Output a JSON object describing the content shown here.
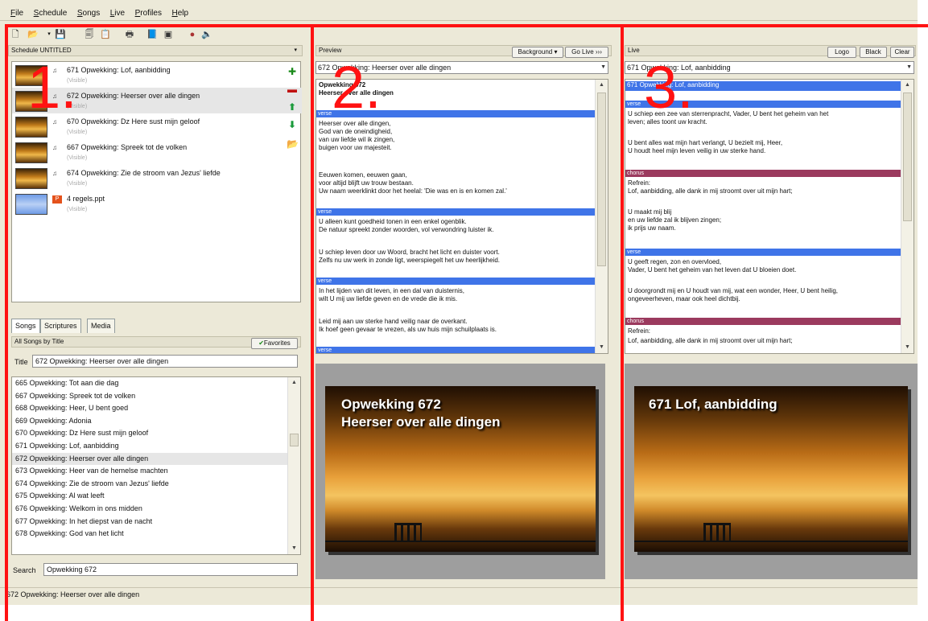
{
  "menu": [
    "File",
    "Schedule",
    "Songs",
    "Live",
    "Profiles",
    "Help"
  ],
  "toolbar_icons": [
    "new-icon",
    "open-icon",
    "save-icon",
    "copy-icon",
    "paste-icon",
    "print-icon",
    "book-icon",
    "window-icon",
    "record-icon",
    "speaker-icon"
  ],
  "schedule": {
    "header": "Schedule UNTITLED",
    "items": [
      {
        "title": "671 Opwekking: Lof, aanbidding",
        "sub": "(Visible)"
      },
      {
        "title": "672 Opwekking: Heerser over alle dingen",
        "sub": "(Visible)"
      },
      {
        "title": "670 Opwekking: Dz Here sust mijn geloof",
        "sub": "(Visible)"
      },
      {
        "title": "667 Opwekking: Spreek tot de volken",
        "sub": "(Visible)"
      },
      {
        "title": "674 Opwekking: Zie de stroom van Jezus' liefde",
        "sub": "(Visible)"
      },
      {
        "title": "4 regels.ppt",
        "sub": "(Visible)"
      }
    ]
  },
  "tabs": [
    "Songs",
    "Scriptures",
    "Media"
  ],
  "songs": {
    "list_header": "All Songs by Title",
    "favorites": "Favorites",
    "title_label": "Title",
    "title_value": "672 Opwekking: Heerser over alle dingen",
    "rows": [
      "665 Opwekking: Tot aan die dag",
      "667 Opwekking: Spreek tot de volken",
      "668 Opwekking: Heer, U bent goed",
      "669 Opwekking: Adonia",
      "670 Opwekking: Dz Here sust mijn geloof",
      "671 Opwekking: Lof, aanbidding",
      "672 Opwekking: Heerser over alle dingen",
      "673 Opwekking: Heer van de hemelse machten",
      "674 Opwekking: Zie de stroom van Jezus' liefde",
      "675 Opwekking: Al wat leeft",
      "676 Opwekking: Welkom in ons midden",
      "677 Opwekking: In het diepst van de nacht",
      "678 Opwekking: God van het licht"
    ],
    "search_label": "Search",
    "search_value": "Opwekking 672"
  },
  "status": "672 Opwekking: Heerser over alle dingen",
  "preview": {
    "header": "Preview",
    "background_btn": "Background ▾",
    "golive_btn": "Go Live ›››",
    "combo": "672 Opwekking: Heerser over alle dingen",
    "title_lines": [
      "Opwekking 672",
      "Heerser over alle dingen"
    ],
    "bands": [
      "verse",
      "verse",
      "verse",
      "verse"
    ],
    "lines": [
      "Heerser over alle dingen,",
      "God van de oneindigheid,",
      "van uw liefde wil ik zingen,",
      "buigen voor uw majesteit.",
      "Eeuwen komen, eeuwen gaan,",
      "voor altijd blijft uw trouw bestaan.",
      "Uw naam weerklinkt door het heelal: 'Die was en is en komen zal.'",
      "U alleen kunt goedheid tonen in een enkel ogenblik.",
      "De natuur spreekt zonder woorden, vol verwondring luister ik.",
      "U schiep leven door uw Woord, bracht het licht en duister voort.",
      "Zelfs nu uw werk in zonde ligt, weerspiegelt het uw heerlijkheid.",
      "In het lijden van dit leven, in een dal van duisternis,",
      "wilt U mij uw liefde geven en de vrede die ik mis.",
      "Leid mij aan uw sterke hand veilig naar de overkant.",
      "Ik hoef geen gevaar te vrezen, als uw huis mijn schuilplaats is."
    ],
    "slide_lines": [
      "Opwekking 672",
      "Heerser over alle dingen"
    ]
  },
  "live": {
    "header": "Live",
    "logo_btn": "Logo",
    "black_btn": "Black",
    "clear_btn": "Clear",
    "combo": "671 Opwekking: Lof, aanbidding",
    "top_band": "671 Opwekking: Lof, aanbidding",
    "bands": [
      "verse",
      "chorus",
      "verse",
      "chorus"
    ],
    "lines": [
      "U schiep een zee van sterrenpracht, Vader, U bent het geheim van het",
      "leven; alles toont uw kracht.",
      "U bent alles wat mijn hart verlangt, U bezielt mij, Heer,",
      "U houdt heel mijn leven veilig in uw sterke hand.",
      "Refrein:",
      "Lof, aanbidding, alle dank in mij stroomt over uit mijn hart;",
      "U maakt mij blij",
      "en uw liefde zal ik blijven zingen;",
      "ik prijs uw naam.",
      "U geeft regen, zon en overvloed,",
      "Vader, U bent het geheim van het leven dat U bloeien doet.",
      "U doorgrondt mij en U houdt van mij, wat een wonder, Heer, U bent heilig,",
      "ongeveerheven, maar ook heel dichtbij.",
      "Refrein:",
      "Lof, aanbidding, alle dank in mij stroomt over uit mijn hart;"
    ],
    "slide_lines": [
      "671   Lof, aanbidding"
    ]
  },
  "annotations": [
    "1.",
    "2.",
    "3."
  ],
  "annotation_color": "#ff1212"
}
